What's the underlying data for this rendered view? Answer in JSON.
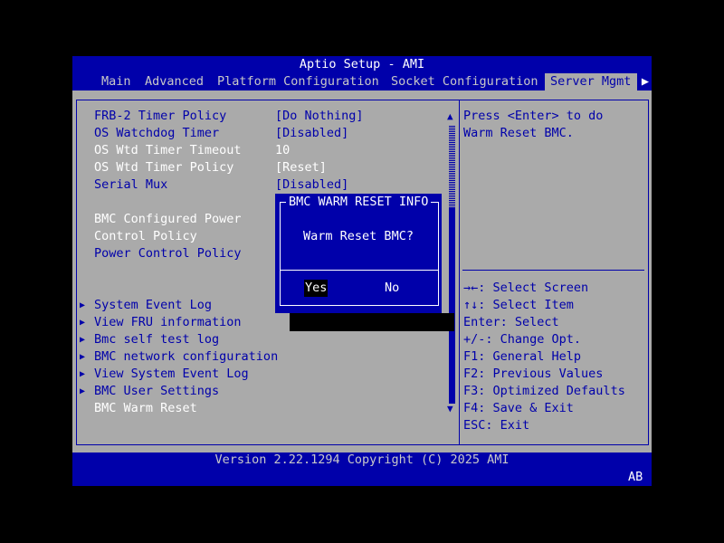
{
  "header": {
    "title": "Aptio Setup - AMI"
  },
  "tabs": [
    {
      "label": "Main"
    },
    {
      "label": "Advanced"
    },
    {
      "label": "Platform Configuration"
    },
    {
      "label": "Socket Configuration"
    },
    {
      "label": "Server Mgmt"
    }
  ],
  "tab_more_glyph": "▶",
  "settings": [
    {
      "label": "FRB-2 Timer Policy",
      "value": "[Do Nothing]"
    },
    {
      "label": "OS Watchdog Timer",
      "value": "[Disabled]"
    },
    {
      "label": "OS Wtd Timer Timeout",
      "value": "10"
    },
    {
      "label": "OS Wtd Timer Policy",
      "value": "[Reset]"
    },
    {
      "label": "Serial Mux",
      "value": "[Disabled]"
    }
  ],
  "bmc_power": {
    "line1": "BMC Configured Power",
    "line2": "Control Policy",
    "policy_label": "Power Control Policy"
  },
  "submenus": [
    {
      "label": "System Event Log"
    },
    {
      "label": "View FRU information"
    },
    {
      "label": "Bmc self test log"
    },
    {
      "label": "BMC network configuration"
    },
    {
      "label": "View System Event Log"
    },
    {
      "label": "BMC User Settings"
    }
  ],
  "submenu_glyph": "▶",
  "warm_reset_item": "BMC Warm Reset",
  "scroll": {
    "up_glyph": "▲",
    "down_glyph": "▼"
  },
  "help": {
    "line1": "Press <Enter> to do",
    "line2": "Warm Reset BMC."
  },
  "keys": [
    {
      "key": "→←",
      "desc": ": Select Screen"
    },
    {
      "key": "↑↓",
      "desc": ": Select Item"
    },
    {
      "key": "Enter",
      "desc": ": Select"
    },
    {
      "key": "+/-",
      "desc": ": Change Opt."
    },
    {
      "key": "F1",
      "desc": ": General Help"
    },
    {
      "key": "F2",
      "desc": ": Previous Values"
    },
    {
      "key": "F3",
      "desc": ": Optimized Defaults"
    },
    {
      "key": "F4",
      "desc": ": Save & Exit"
    },
    {
      "key": "ESC",
      "desc": ": Exit"
    }
  ],
  "dialog": {
    "title": "BMC WARM RESET INFO",
    "message": "Warm Reset BMC?",
    "yes": "Yes",
    "no": "No"
  },
  "footer": {
    "version": "Version 2.22.1294 Copyright (C) 2025 AMI",
    "corner": "AB"
  },
  "colors": {
    "frame": "#0000aa",
    "panel": "#aaaaaa",
    "text_white": "#ffffff",
    "highlight": "#000000"
  }
}
